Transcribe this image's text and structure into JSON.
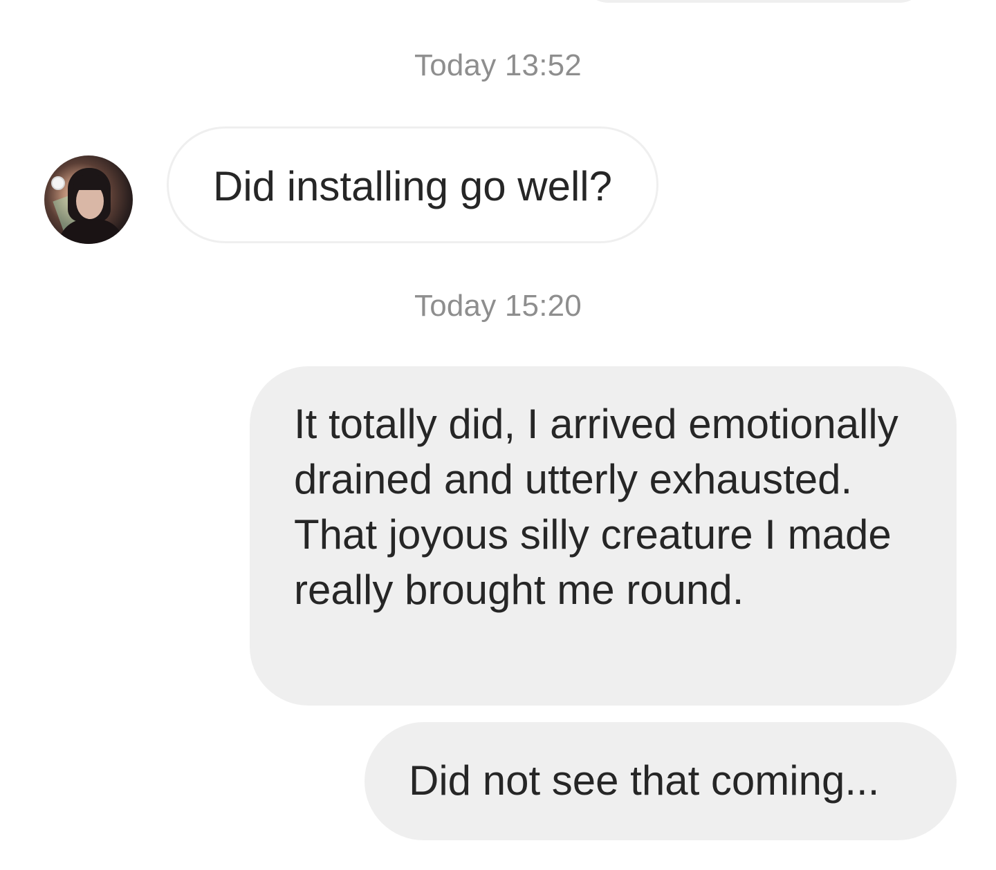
{
  "thread": {
    "messages": [
      {
        "timestamp": "Today 13:52",
        "direction": "received",
        "text": "Did installing go well?"
      },
      {
        "timestamp": "Today 15:20",
        "direction": "sent",
        "text": "It totally did, I arrived emotionally drained and utterly exhausted. That joyous silly creature I made really brought me round."
      },
      {
        "direction": "sent",
        "text": "Did not see that coming..."
      }
    ]
  },
  "colors": {
    "sent_bubble": "#efefef",
    "received_bubble_border": "#efefef",
    "timestamp_text": "#8e8e8e",
    "message_text": "#262626"
  }
}
